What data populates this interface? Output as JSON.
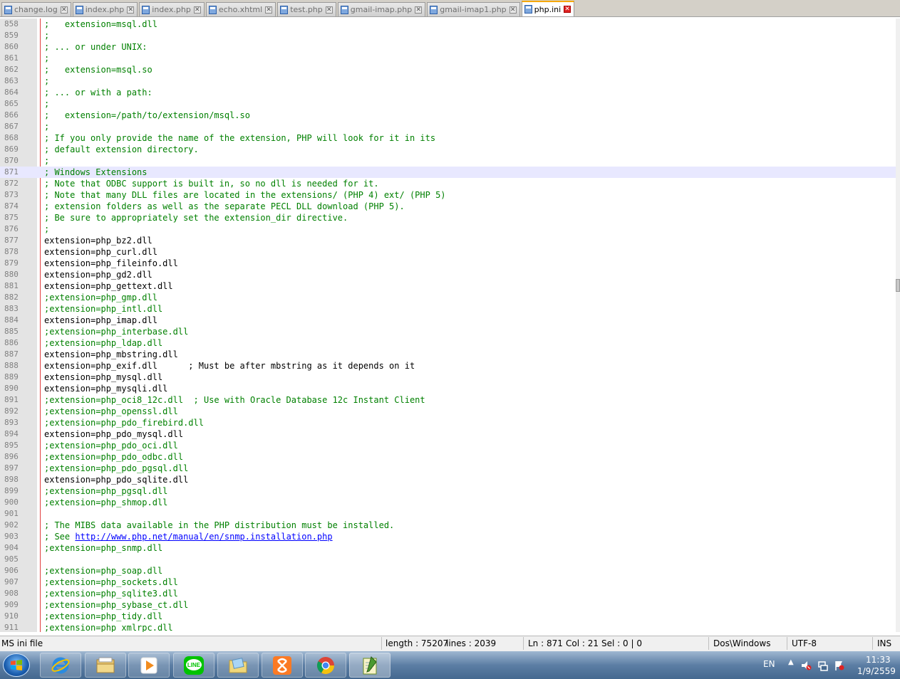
{
  "tabs": [
    {
      "label": "change.log",
      "active": false
    },
    {
      "label": "index.php",
      "active": false
    },
    {
      "label": "index.php",
      "active": false
    },
    {
      "label": "echo.xhtml",
      "active": false
    },
    {
      "label": "test.php",
      "active": false
    },
    {
      "label": "gmail-imap.php",
      "active": false
    },
    {
      "label": "gmail-imap1.php",
      "active": false
    },
    {
      "label": "php.ini",
      "active": true
    }
  ],
  "editor": {
    "highlighted_line": 871,
    "lines": [
      {
        "n": "858",
        "t": ";   extension=msql.dll",
        "k": "comment"
      },
      {
        "n": "859",
        "t": ";",
        "k": "comment"
      },
      {
        "n": "860",
        "t": "; ... or under UNIX:",
        "k": "comment"
      },
      {
        "n": "861",
        "t": ";",
        "k": "comment"
      },
      {
        "n": "862",
        "t": ";   extension=msql.so",
        "k": "comment"
      },
      {
        "n": "863",
        "t": ";",
        "k": "comment"
      },
      {
        "n": "864",
        "t": "; ... or with a path:",
        "k": "comment"
      },
      {
        "n": "865",
        "t": ";",
        "k": "comment"
      },
      {
        "n": "866",
        "t": ";   extension=/path/to/extension/msql.so",
        "k": "comment"
      },
      {
        "n": "867",
        "t": ";",
        "k": "comment"
      },
      {
        "n": "868",
        "t": "; If you only provide the name of the extension, PHP will look for it in its",
        "k": "comment"
      },
      {
        "n": "869",
        "t": "; default extension directory.",
        "k": "comment"
      },
      {
        "n": "870",
        "t": ";",
        "k": "comment"
      },
      {
        "n": "871",
        "t": "; Windows Extensions",
        "k": "comment"
      },
      {
        "n": "872",
        "t": "; Note that ODBC support is built in, so no dll is needed for it.",
        "k": "comment"
      },
      {
        "n": "873",
        "t": "; Note that many DLL files are located in the extensions/ (PHP 4) ext/ (PHP 5)",
        "k": "comment"
      },
      {
        "n": "874",
        "t": "; extension folders as well as the separate PECL DLL download (PHP 5).",
        "k": "comment"
      },
      {
        "n": "875",
        "t": "; Be sure to appropriately set the extension_dir directive.",
        "k": "comment"
      },
      {
        "n": "876",
        "t": ";",
        "k": "comment"
      },
      {
        "n": "877",
        "t": "extension=php_bz2.dll",
        "k": "plain"
      },
      {
        "n": "878",
        "t": "extension=php_curl.dll",
        "k": "plain"
      },
      {
        "n": "879",
        "t": "extension=php_fileinfo.dll",
        "k": "plain"
      },
      {
        "n": "880",
        "t": "extension=php_gd2.dll",
        "k": "plain"
      },
      {
        "n": "881",
        "t": "extension=php_gettext.dll",
        "k": "plain"
      },
      {
        "n": "882",
        "t": ";extension=php_gmp.dll",
        "k": "comment"
      },
      {
        "n": "883",
        "t": ";extension=php_intl.dll",
        "k": "comment"
      },
      {
        "n": "884",
        "t": "extension=php_imap.dll",
        "k": "plain"
      },
      {
        "n": "885",
        "t": ";extension=php_interbase.dll",
        "k": "comment"
      },
      {
        "n": "886",
        "t": ";extension=php_ldap.dll",
        "k": "comment"
      },
      {
        "n": "887",
        "t": "extension=php_mbstring.dll",
        "k": "plain"
      },
      {
        "n": "888",
        "t": "extension=php_exif.dll      ; Must be after mbstring as it depends on it",
        "k": "plain"
      },
      {
        "n": "889",
        "t": "extension=php_mysql.dll",
        "k": "plain"
      },
      {
        "n": "890",
        "t": "extension=php_mysqli.dll",
        "k": "plain"
      },
      {
        "n": "891",
        "t": ";extension=php_oci8_12c.dll  ; Use with Oracle Database 12c Instant Client",
        "k": "comment"
      },
      {
        "n": "892",
        "t": ";extension=php_openssl.dll",
        "k": "comment"
      },
      {
        "n": "893",
        "t": ";extension=php_pdo_firebird.dll",
        "k": "comment"
      },
      {
        "n": "894",
        "t": "extension=php_pdo_mysql.dll",
        "k": "plain"
      },
      {
        "n": "895",
        "t": ";extension=php_pdo_oci.dll",
        "k": "comment"
      },
      {
        "n": "896",
        "t": ";extension=php_pdo_odbc.dll",
        "k": "comment"
      },
      {
        "n": "897",
        "t": ";extension=php_pdo_pgsql.dll",
        "k": "comment"
      },
      {
        "n": "898",
        "t": "extension=php_pdo_sqlite.dll",
        "k": "plain"
      },
      {
        "n": "899",
        "t": ";extension=php_pgsql.dll",
        "k": "comment"
      },
      {
        "n": "900",
        "t": ";extension=php_shmop.dll",
        "k": "comment"
      },
      {
        "n": "901",
        "t": "",
        "k": "plain"
      },
      {
        "n": "902",
        "t": "; The MIBS data available in the PHP distribution must be installed.",
        "k": "comment"
      },
      {
        "n": "903",
        "t": "; See ",
        "k": "comment",
        "url": "http://www.php.net/manual/en/snmp.installation.php"
      },
      {
        "n": "904",
        "t": ";extension=php_snmp.dll",
        "k": "comment"
      },
      {
        "n": "905",
        "t": "",
        "k": "plain"
      },
      {
        "n": "906",
        "t": ";extension=php_soap.dll",
        "k": "comment"
      },
      {
        "n": "907",
        "t": ";extension=php_sockets.dll",
        "k": "comment"
      },
      {
        "n": "908",
        "t": ";extension=php_sqlite3.dll",
        "k": "comment"
      },
      {
        "n": "909",
        "t": ";extension=php_sybase_ct.dll",
        "k": "comment"
      },
      {
        "n": "910",
        "t": ";extension=php_tidy.dll",
        "k": "comment"
      },
      {
        "n": "911",
        "t": ";extension=php_xmlrpc.dll",
        "k": "comment"
      }
    ]
  },
  "statusbar": {
    "filetype": "MS ini file",
    "length": "length : 75207",
    "lines": "lines : 2039",
    "ln": "Ln : 871",
    "col": "Col : 21",
    "sel": "Sel : 0 | 0",
    "eol": "Dos\\Windows",
    "encoding": "UTF-8",
    "mode": "INS"
  },
  "taskbar": {
    "apps": [
      {
        "icon": "internet-explorer-icon"
      },
      {
        "icon": "file-explorer-icon"
      },
      {
        "icon": "media-player-icon"
      },
      {
        "icon": "line-icon",
        "label": "LINE"
      },
      {
        "icon": "folder-icon"
      },
      {
        "icon": "xampp-icon"
      },
      {
        "icon": "chrome-icon"
      },
      {
        "icon": "notepadpp-icon"
      }
    ],
    "language": "EN",
    "time": "11:33",
    "date": "1/9/2559"
  }
}
